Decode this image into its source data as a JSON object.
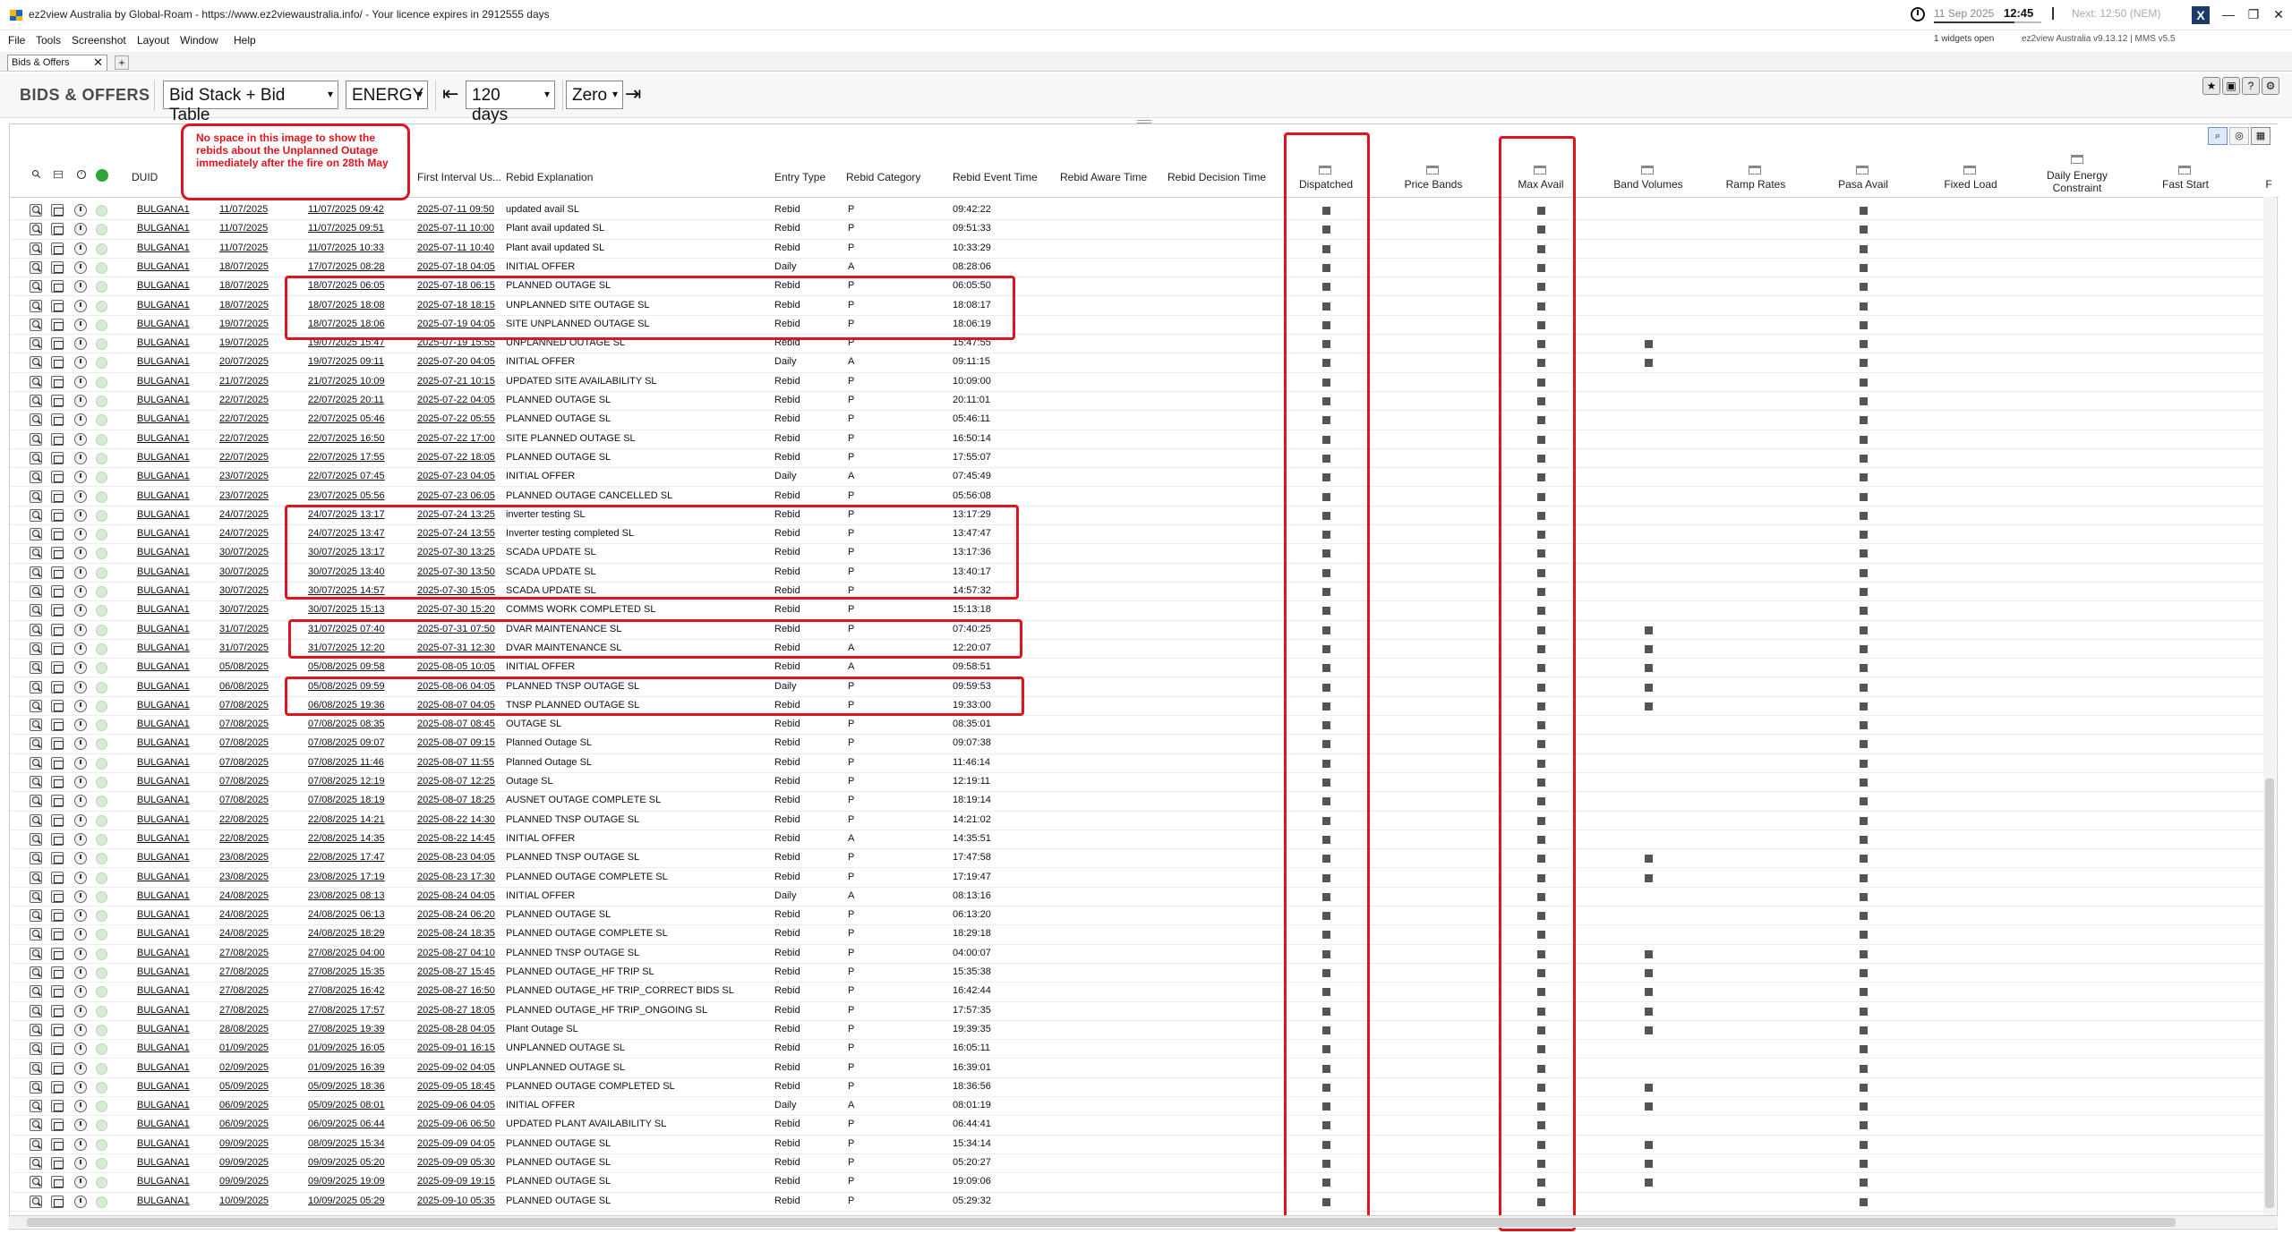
{
  "titlebar": {
    "title": "ez2view Australia by Global-Roam - https://www.ez2viewaustralia.info/ - Your licence expires in 2912555 days",
    "date": "11 Sep 2025",
    "time": "12:45",
    "next": "Next: 12:50 (NEM)",
    "minimize": "—",
    "restore": "❐",
    "close": "✕"
  },
  "menu": {
    "items": [
      "File",
      "Tools",
      "Screenshot",
      "Layout",
      "Window",
      "Help"
    ],
    "widgets_open": "1 widgets open",
    "version": "ez2view Australia v9.13.12 | MMS v5.5"
  },
  "tab": {
    "label": "Bids & Offers",
    "close": "✕",
    "add": "+"
  },
  "toolbar": {
    "title": "BIDS & OFFERS",
    "view_select": "Bid Stack + Bid Table",
    "type_select": "ENERGY",
    "range_select": "120 days",
    "zero_select": "Zero",
    "back": "⇤",
    "forward": "⇥"
  },
  "annotation": {
    "callout": "No space in this image to show the rebids about the Unplanned Outage immediately after the fire on 28th May"
  },
  "headers": {
    "duid": "DUID",
    "first_interval": "First Interval Us...",
    "rebid_explanation": "Rebid Explanation",
    "entry_type": "Entry Type",
    "rebid_category": "Rebid Category",
    "rebid_event_time": "Rebid Event Time",
    "rebid_aware_time": "Rebid Aware Time",
    "rebid_decision_time": "Rebid Decision Time",
    "dispatched": "Dispatched",
    "price_bands": "Price Bands",
    "max_avail": "Max Avail",
    "band_volumes": "Band Volumes",
    "ramp_rates": "Ramp Rates",
    "pasa_avail": "Pasa Avail",
    "fixed_load": "Fixed Load",
    "daily_energy": "Daily Energy Constraint",
    "fast_start": "Fast Start",
    "more": "F"
  },
  "rows": [
    [
      "BULGANA1",
      "11/07/2025",
      "11/07/2025 09:42",
      "2025-07-11 09:50",
      "updated avail SL",
      "Rebid",
      "P",
      "09:42:22",
      0
    ],
    [
      "BULGANA1",
      "11/07/2025",
      "11/07/2025 09:51",
      "2025-07-11 10:00",
      "Plant avail updated SL",
      "Rebid",
      "P",
      "09:51:33",
      0
    ],
    [
      "BULGANA1",
      "11/07/2025",
      "11/07/2025 10:33",
      "2025-07-11 10:40",
      "Plant avail updated SL",
      "Rebid",
      "P",
      "10:33:29",
      0
    ],
    [
      "BULGANA1",
      "18/07/2025",
      "17/07/2025 08:28",
      "2025-07-18 04:05",
      "INITIAL OFFER",
      "Daily",
      "A",
      "08:28:06",
      0
    ],
    [
      "BULGANA1",
      "18/07/2025",
      "18/07/2025 06:05",
      "2025-07-18 06:15",
      "PLANNED OUTAGE SL",
      "Rebid",
      "P",
      "06:05:50",
      0
    ],
    [
      "BULGANA1",
      "18/07/2025",
      "18/07/2025 18:08",
      "2025-07-18 18:15",
      "UNPLANNED SITE OUTAGE SL",
      "Rebid",
      "P",
      "18:08:17",
      0
    ],
    [
      "BULGANA1",
      "19/07/2025",
      "18/07/2025 18:06",
      "2025-07-19 04:05",
      "SITE UNPLANNED OUTAGE SL",
      "Rebid",
      "P",
      "18:06:19",
      0
    ],
    [
      "BULGANA1",
      "19/07/2025",
      "19/07/2025 15:47",
      "2025-07-19 15:55",
      "UNPLANNED OUTAGE SL",
      "Rebid",
      "P",
      "15:47:55",
      1
    ],
    [
      "BULGANA1",
      "20/07/2025",
      "19/07/2025 09:11",
      "2025-07-20 04:05",
      "INITIAL OFFER",
      "Daily",
      "A",
      "09:11:15",
      1
    ],
    [
      "BULGANA1",
      "21/07/2025",
      "21/07/2025 10:09",
      "2025-07-21 10:15",
      "UPDATED SITE AVAILABILITY SL",
      "Rebid",
      "P",
      "10:09:00",
      0
    ],
    [
      "BULGANA1",
      "22/07/2025",
      "22/07/2025 20:11",
      "2025-07-22 04:05",
      "PLANNED OUTAGE SL",
      "Rebid",
      "P",
      "20:11:01",
      0
    ],
    [
      "BULGANA1",
      "22/07/2025",
      "22/07/2025 05:46",
      "2025-07-22 05:55",
      "PLANNED OUTAGE SL",
      "Rebid",
      "P",
      "05:46:11",
      0
    ],
    [
      "BULGANA1",
      "22/07/2025",
      "22/07/2025 16:50",
      "2025-07-22 17:00",
      "SITE PLANNED OUTAGE SL",
      "Rebid",
      "P",
      "16:50:14",
      0
    ],
    [
      "BULGANA1",
      "22/07/2025",
      "22/07/2025 17:55",
      "2025-07-22 18:05",
      "PLANNED OUTAGE SL",
      "Rebid",
      "P",
      "17:55:07",
      0
    ],
    [
      "BULGANA1",
      "23/07/2025",
      "22/07/2025 07:45",
      "2025-07-23 04:05",
      "INITIAL OFFER",
      "Daily",
      "A",
      "07:45:49",
      0
    ],
    [
      "BULGANA1",
      "23/07/2025",
      "23/07/2025 05:56",
      "2025-07-23 06:05",
      "PLANNED OUTAGE CANCELLED SL",
      "Rebid",
      "P",
      "05:56:08",
      0
    ],
    [
      "BULGANA1",
      "24/07/2025",
      "24/07/2025 13:17",
      "2025-07-24 13:25",
      "inverter testing SL",
      "Rebid",
      "P",
      "13:17:29",
      0
    ],
    [
      "BULGANA1",
      "24/07/2025",
      "24/07/2025 13:47",
      "2025-07-24 13:55",
      "Inverter testing completed SL",
      "Rebid",
      "P",
      "13:47:47",
      0
    ],
    [
      "BULGANA1",
      "30/07/2025",
      "30/07/2025 13:17",
      "2025-07-30 13:25",
      "SCADA UPDATE SL",
      "Rebid",
      "P",
      "13:17:36",
      0
    ],
    [
      "BULGANA1",
      "30/07/2025",
      "30/07/2025 13:40",
      "2025-07-30 13:50",
      "SCADA UPDATE SL",
      "Rebid",
      "P",
      "13:40:17",
      0
    ],
    [
      "BULGANA1",
      "30/07/2025",
      "30/07/2025 14:57",
      "2025-07-30 15:05",
      "SCADA UPDATE SL",
      "Rebid",
      "P",
      "14:57:32",
      0
    ],
    [
      "BULGANA1",
      "30/07/2025",
      "30/07/2025 15:13",
      "2025-07-30 15:20",
      "COMMS WORK COMPLETED SL",
      "Rebid",
      "P",
      "15:13:18",
      0
    ],
    [
      "BULGANA1",
      "31/07/2025",
      "31/07/2025 07:40",
      "2025-07-31 07:50",
      "DVAR MAINTENANCE SL",
      "Rebid",
      "P",
      "07:40:25",
      1
    ],
    [
      "BULGANA1",
      "31/07/2025",
      "31/07/2025 12:20",
      "2025-07-31 12:30",
      "DVAR MAINTENANCE SL",
      "Rebid",
      "A",
      "12:20:07",
      1
    ],
    [
      "BULGANA1",
      "05/08/2025",
      "05/08/2025 09:58",
      "2025-08-05 10:05",
      "INITIAL OFFER",
      "Rebid",
      "A",
      "09:58:51",
      1
    ],
    [
      "BULGANA1",
      "06/08/2025",
      "05/08/2025 09:59",
      "2025-08-06 04:05",
      "PLANNED TNSP OUTAGE SL",
      "Daily",
      "P",
      "09:59:53",
      1
    ],
    [
      "BULGANA1",
      "07/08/2025",
      "06/08/2025 19:36",
      "2025-08-07 04:05",
      "TNSP PLANNED OUTAGE SL",
      "Rebid",
      "P",
      "19:33:00",
      1
    ],
    [
      "BULGANA1",
      "07/08/2025",
      "07/08/2025 08:35",
      "2025-08-07 08:45",
      "OUTAGE SL",
      "Rebid",
      "P",
      "08:35:01",
      0
    ],
    [
      "BULGANA1",
      "07/08/2025",
      "07/08/2025 09:07",
      "2025-08-07 09:15",
      "Planned Outage SL",
      "Rebid",
      "P",
      "09:07:38",
      0
    ],
    [
      "BULGANA1",
      "07/08/2025",
      "07/08/2025 11:46",
      "2025-08-07 11:55",
      "Planned Outage SL",
      "Rebid",
      "P",
      "11:46:14",
      0
    ],
    [
      "BULGANA1",
      "07/08/2025",
      "07/08/2025 12:19",
      "2025-08-07 12:25",
      "Outage SL",
      "Rebid",
      "P",
      "12:19:11",
      0
    ],
    [
      "BULGANA1",
      "07/08/2025",
      "07/08/2025 18:19",
      "2025-08-07 18:25",
      "AUSNET OUTAGE COMPLETE SL",
      "Rebid",
      "P",
      "18:19:14",
      0
    ],
    [
      "BULGANA1",
      "22/08/2025",
      "22/08/2025 14:21",
      "2025-08-22 14:30",
      "PLANNED TNSP OUTAGE SL",
      "Rebid",
      "P",
      "14:21:02",
      0
    ],
    [
      "BULGANA1",
      "22/08/2025",
      "22/08/2025 14:35",
      "2025-08-22 14:45",
      "INITIAL OFFER",
      "Rebid",
      "A",
      "14:35:51",
      0
    ],
    [
      "BULGANA1",
      "23/08/2025",
      "22/08/2025 17:47",
      "2025-08-23 04:05",
      "PLANNED TNSP OUTAGE SL",
      "Rebid",
      "P",
      "17:47:58",
      1
    ],
    [
      "BULGANA1",
      "23/08/2025",
      "23/08/2025 17:19",
      "2025-08-23 17:30",
      "PLANNED OUTAGE COMPLETE SL",
      "Rebid",
      "P",
      "17:19:47",
      1
    ],
    [
      "BULGANA1",
      "24/08/2025",
      "23/08/2025 08:13",
      "2025-08-24 04:05",
      "INITIAL OFFER",
      "Daily",
      "A",
      "08:13:16",
      0
    ],
    [
      "BULGANA1",
      "24/08/2025",
      "24/08/2025 06:13",
      "2025-08-24 06:20",
      "PLANNED OUTAGE SL",
      "Rebid",
      "P",
      "06:13:20",
      0
    ],
    [
      "BULGANA1",
      "24/08/2025",
      "24/08/2025 18:29",
      "2025-08-24 18:35",
      "PLANNED OUTAGE COMPLETE SL",
      "Rebid",
      "P",
      "18:29:18",
      0
    ],
    [
      "BULGANA1",
      "27/08/2025",
      "27/08/2025 04:00",
      "2025-08-27 04:10",
      "PLANNED TNSP OUTAGE SL",
      "Rebid",
      "P",
      "04:00:07",
      1
    ],
    [
      "BULGANA1",
      "27/08/2025",
      "27/08/2025 15:35",
      "2025-08-27 15:45",
      "PLANNED OUTAGE_HF TRIP SL",
      "Rebid",
      "P",
      "15:35:38",
      1
    ],
    [
      "BULGANA1",
      "27/08/2025",
      "27/08/2025 16:42",
      "2025-08-27 16:50",
      "PLANNED OUTAGE_HF TRIP_CORRECT BIDS SL",
      "Rebid",
      "P",
      "16:42:44",
      1
    ],
    [
      "BULGANA1",
      "27/08/2025",
      "27/08/2025 17:57",
      "2025-08-27 18:05",
      "PLANNED OUTAGE_HF TRIP_ONGOING SL",
      "Rebid",
      "P",
      "17:57:35",
      1
    ],
    [
      "BULGANA1",
      "28/08/2025",
      "27/08/2025 19:39",
      "2025-08-28 04:05",
      "Plant Outage SL",
      "Rebid",
      "P",
      "19:39:35",
      1
    ],
    [
      "BULGANA1",
      "01/09/2025",
      "01/09/2025 16:05",
      "2025-09-01 16:15",
      "UNPLANNED OUTAGE SL",
      "Rebid",
      "P",
      "16:05:11",
      0
    ],
    [
      "BULGANA1",
      "02/09/2025",
      "01/09/2025 16:39",
      "2025-09-02 04:05",
      "UNPLANNED OUTAGE SL",
      "Rebid",
      "P",
      "16:39:01",
      0
    ],
    [
      "BULGANA1",
      "05/09/2025",
      "05/09/2025 18:36",
      "2025-09-05 18:45",
      "PLANNED OUTAGE COMPLETED SL",
      "Rebid",
      "P",
      "18:36:56",
      1
    ],
    [
      "BULGANA1",
      "06/09/2025",
      "05/09/2025 08:01",
      "2025-09-06 04:05",
      "INITIAL OFFER",
      "Daily",
      "A",
      "08:01:19",
      1
    ],
    [
      "BULGANA1",
      "06/09/2025",
      "06/09/2025 06:44",
      "2025-09-06 06:50",
      "UPDATED PLANT AVAILABILITY SL",
      "Rebid",
      "P",
      "06:44:41",
      0
    ],
    [
      "BULGANA1",
      "09/09/2025",
      "08/09/2025 15:34",
      "2025-09-09 04:05",
      "PLANNED OUTAGE SL",
      "Rebid",
      "P",
      "15:34:14",
      1
    ],
    [
      "BULGANA1",
      "09/09/2025",
      "09/09/2025 05:20",
      "2025-09-09 05:30",
      "PLANNED OUTAGE SL",
      "Rebid",
      "P",
      "05:20:27",
      1
    ],
    [
      "BULGANA1",
      "09/09/2025",
      "09/09/2025 19:09",
      "2025-09-09 19:15",
      "PLANNED OUTAGE SL",
      "Rebid",
      "P",
      "19:09:06",
      1
    ],
    [
      "BULGANA1",
      "10/09/2025",
      "10/09/2025 05:29",
      "2025-09-10 05:35",
      "PLANNED OUTAGE SL",
      "Rebid",
      "P",
      "05:29:32",
      0
    ]
  ]
}
